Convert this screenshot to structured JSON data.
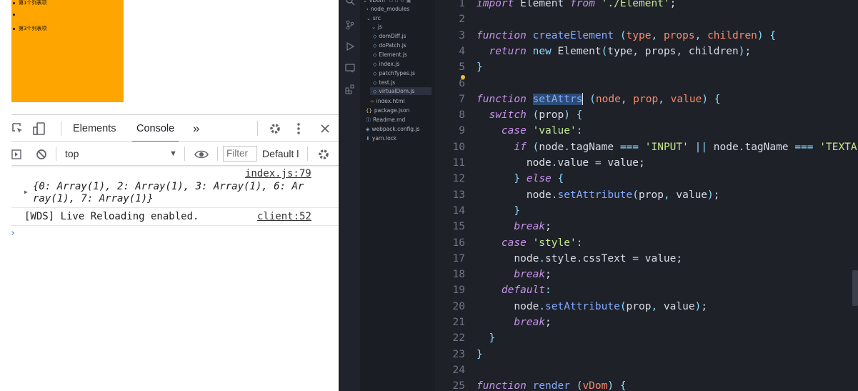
{
  "browser_page": {
    "list_items": [
      "第1个列表项",
      "",
      "第3个列表项"
    ],
    "block_color": "#ffa500"
  },
  "devtools": {
    "tabs": [
      "Elements",
      "Console"
    ],
    "more_tabs_label": "»",
    "context": "top",
    "filter_placeholder": "Filter",
    "levels": "Default l",
    "messages": [
      {
        "text_line1": "{0: Array(1), 2: Array(1), 3: Array(1), 6: Ar",
        "text_line2": "ray(1), 7: Array(1)}",
        "source": "index.js:79"
      },
      {
        "text_line1": "[WDS] Live Reloading enabled.",
        "source": "client:52"
      }
    ],
    "prompt": "›",
    "icons": [
      "inspect-icon",
      "device-icon",
      "gear-icon",
      "kebab-icon",
      "close-icon",
      "sidebar-icon",
      "clear-icon",
      "eye-icon"
    ]
  },
  "explorer": {
    "items": [
      {
        "label": "vDom",
        "kind": "folder-open"
      },
      {
        "label": "node_modules",
        "kind": "folder"
      },
      {
        "label": "src",
        "kind": "folder-open"
      },
      {
        "label": "js",
        "kind": "folder-open"
      },
      {
        "label": "domDiff.js",
        "kind": "js"
      },
      {
        "label": "doPatch.js",
        "kind": "js"
      },
      {
        "label": "Element.js",
        "kind": "js"
      },
      {
        "label": "index.js",
        "kind": "js"
      },
      {
        "label": "patchTypes.js",
        "kind": "js"
      },
      {
        "label": "test.js",
        "kind": "js"
      },
      {
        "label": "virtualDom.js",
        "kind": "js",
        "selected": true
      },
      {
        "label": "index.html",
        "kind": "html"
      },
      {
        "label": "package.json",
        "kind": "json"
      },
      {
        "label": "Readme.md",
        "kind": "md"
      },
      {
        "label": "webpack.config.js",
        "kind": "config"
      },
      {
        "label": "yarn.lock",
        "kind": "lock"
      }
    ]
  },
  "editor": {
    "lines": [
      {
        "n": "1",
        "tokens": [
          [
            "kw",
            "import"
          ],
          [
            "pl",
            " Element "
          ],
          [
            "kw",
            "from"
          ],
          [
            "pl",
            " "
          ],
          [
            "str",
            "'./Element'"
          ],
          [
            "pl",
            ";"
          ]
        ]
      },
      {
        "n": "2",
        "tokens": []
      },
      {
        "n": "3",
        "tokens": [
          [
            "kw",
            "function"
          ],
          [
            "pl",
            " "
          ],
          [
            "fn",
            "createElement"
          ],
          [
            "pl",
            " "
          ],
          [
            "op",
            "("
          ],
          [
            "prm",
            "type"
          ],
          [
            "op",
            ","
          ],
          [
            "pl",
            " "
          ],
          [
            "prm",
            "props"
          ],
          [
            "op",
            ","
          ],
          [
            "pl",
            " "
          ],
          [
            "prm",
            "children"
          ],
          [
            "op",
            ")"
          ],
          [
            "pl",
            " "
          ],
          [
            "op",
            "{"
          ]
        ]
      },
      {
        "n": "4",
        "tokens": [
          [
            "pl",
            "  "
          ],
          [
            "kw",
            "return"
          ],
          [
            "pl",
            " "
          ],
          [
            "op",
            "new"
          ],
          [
            "pl",
            " Element"
          ],
          [
            "op",
            "("
          ],
          [
            "pl",
            "type"
          ],
          [
            "op",
            ","
          ],
          [
            "pl",
            " props"
          ],
          [
            "op",
            ","
          ],
          [
            "pl",
            " children"
          ],
          [
            "op",
            ")"
          ],
          [
            "pl",
            ";"
          ]
        ]
      },
      {
        "n": "5",
        "tokens": [
          [
            "op",
            "}"
          ]
        ]
      },
      {
        "n": "6",
        "tokens": []
      },
      {
        "n": "7",
        "tokens": [
          [
            "kw",
            "function"
          ],
          [
            "pl",
            " "
          ],
          [
            "hl",
            "setAttrs"
          ],
          [
            "cursor",
            ""
          ],
          [
            "pl",
            " "
          ],
          [
            "op",
            "("
          ],
          [
            "prm",
            "node"
          ],
          [
            "op",
            ","
          ],
          [
            "pl",
            " "
          ],
          [
            "prm",
            "prop"
          ],
          [
            "op",
            ","
          ],
          [
            "pl",
            " "
          ],
          [
            "prm",
            "value"
          ],
          [
            "op",
            ")"
          ],
          [
            "pl",
            " "
          ],
          [
            "op",
            "{"
          ]
        ]
      },
      {
        "n": "8",
        "tokens": [
          [
            "pl",
            "  "
          ],
          [
            "kw",
            "switch"
          ],
          [
            "pl",
            " "
          ],
          [
            "op",
            "("
          ],
          [
            "pl",
            "prop"
          ],
          [
            "op",
            ")"
          ],
          [
            "pl",
            " "
          ],
          [
            "op",
            "{"
          ]
        ]
      },
      {
        "n": "9",
        "tokens": [
          [
            "pl",
            "    "
          ],
          [
            "kw",
            "case"
          ],
          [
            "pl",
            " "
          ],
          [
            "str",
            "'value'"
          ],
          [
            "op",
            ":"
          ]
        ]
      },
      {
        "n": "10",
        "tokens": [
          [
            "pl",
            "      "
          ],
          [
            "kw",
            "if"
          ],
          [
            "pl",
            " "
          ],
          [
            "op",
            "("
          ],
          [
            "pl",
            "node"
          ],
          [
            "op",
            "."
          ],
          [
            "pl",
            "tagName "
          ],
          [
            "op",
            "==="
          ],
          [
            "pl",
            " "
          ],
          [
            "str",
            "'INPUT'"
          ],
          [
            "pl",
            " "
          ],
          [
            "op",
            "||"
          ],
          [
            "pl",
            " node"
          ],
          [
            "op",
            "."
          ],
          [
            "pl",
            "tagName "
          ],
          [
            "op",
            "==="
          ],
          [
            "pl",
            " "
          ],
          [
            "str",
            "'TEXTA"
          ]
        ]
      },
      {
        "n": "11",
        "tokens": [
          [
            "pl",
            "        node"
          ],
          [
            "op",
            "."
          ],
          [
            "pl",
            "value "
          ],
          [
            "op",
            "="
          ],
          [
            "pl",
            " value;"
          ]
        ]
      },
      {
        "n": "12",
        "tokens": [
          [
            "pl",
            "      "
          ],
          [
            "op",
            "}"
          ],
          [
            "pl",
            " "
          ],
          [
            "kw",
            "else"
          ],
          [
            "pl",
            " "
          ],
          [
            "op",
            "{"
          ]
        ]
      },
      {
        "n": "13",
        "tokens": [
          [
            "pl",
            "        node"
          ],
          [
            "op",
            "."
          ],
          [
            "fn",
            "setAttribute"
          ],
          [
            "op",
            "("
          ],
          [
            "pl",
            "prop"
          ],
          [
            "op",
            ","
          ],
          [
            "pl",
            " value"
          ],
          [
            "op",
            ")"
          ],
          [
            "pl",
            ";"
          ]
        ]
      },
      {
        "n": "14",
        "tokens": [
          [
            "pl",
            "      "
          ],
          [
            "op",
            "}"
          ]
        ]
      },
      {
        "n": "15",
        "tokens": [
          [
            "pl",
            "      "
          ],
          [
            "kw",
            "break"
          ],
          [
            "pl",
            ";"
          ]
        ]
      },
      {
        "n": "16",
        "tokens": [
          [
            "pl",
            "    "
          ],
          [
            "kw",
            "case"
          ],
          [
            "pl",
            " "
          ],
          [
            "str",
            "'style'"
          ],
          [
            "op",
            ":"
          ]
        ]
      },
      {
        "n": "17",
        "tokens": [
          [
            "pl",
            "      node"
          ],
          [
            "op",
            "."
          ],
          [
            "pl",
            "style"
          ],
          [
            "op",
            "."
          ],
          [
            "pl",
            "cssText "
          ],
          [
            "op",
            "="
          ],
          [
            "pl",
            " value;"
          ]
        ]
      },
      {
        "n": "18",
        "tokens": [
          [
            "pl",
            "      "
          ],
          [
            "kw",
            "break"
          ],
          [
            "pl",
            ";"
          ]
        ]
      },
      {
        "n": "19",
        "tokens": [
          [
            "pl",
            "    "
          ],
          [
            "kw",
            "default"
          ],
          [
            "op",
            ":"
          ]
        ]
      },
      {
        "n": "20",
        "tokens": [
          [
            "pl",
            "      node"
          ],
          [
            "op",
            "."
          ],
          [
            "fn",
            "setAttribute"
          ],
          [
            "op",
            "("
          ],
          [
            "pl",
            "prop"
          ],
          [
            "op",
            ","
          ],
          [
            "pl",
            " value"
          ],
          [
            "op",
            ")"
          ],
          [
            "pl",
            ";"
          ]
        ]
      },
      {
        "n": "21",
        "tokens": [
          [
            "pl",
            "      "
          ],
          [
            "kw",
            "break"
          ],
          [
            "pl",
            ";"
          ]
        ]
      },
      {
        "n": "22",
        "tokens": [
          [
            "pl",
            "  "
          ],
          [
            "op",
            "}"
          ]
        ]
      },
      {
        "n": "23",
        "tokens": [
          [
            "op",
            "}"
          ]
        ]
      },
      {
        "n": "24",
        "tokens": []
      },
      {
        "n": "25",
        "tokens": [
          [
            "kw",
            "function"
          ],
          [
            "pl",
            " "
          ],
          [
            "fn",
            "render"
          ],
          [
            "pl",
            " "
          ],
          [
            "op",
            "("
          ],
          [
            "prm",
            "vDom"
          ],
          [
            "op",
            ")"
          ],
          [
            "pl",
            " "
          ],
          [
            "op",
            "{"
          ]
        ]
      }
    ]
  }
}
